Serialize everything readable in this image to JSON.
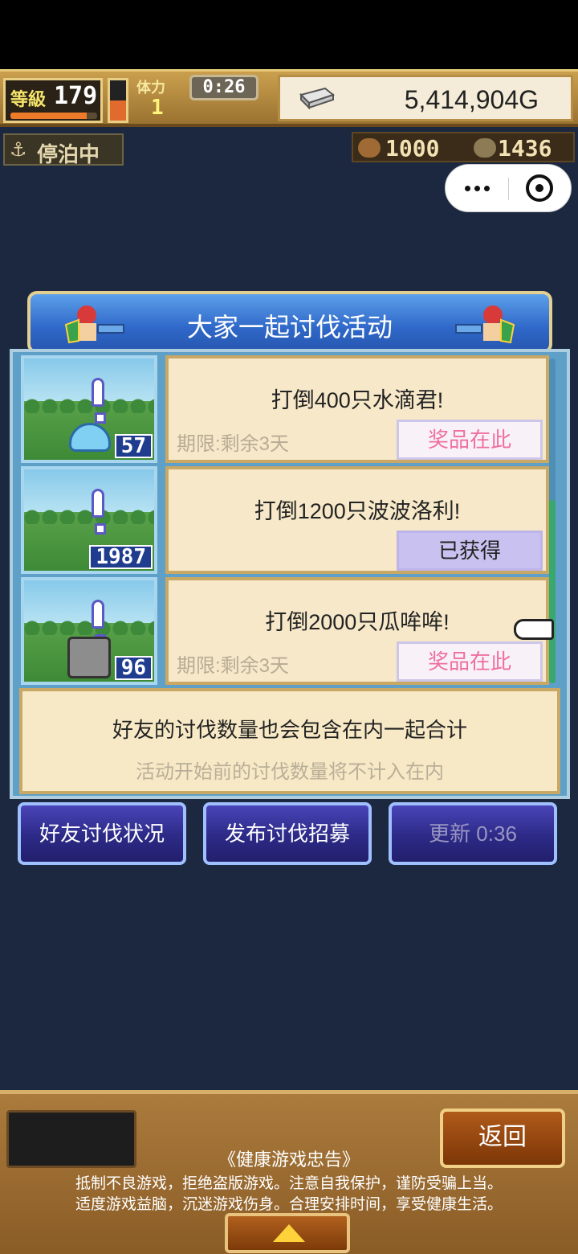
{
  "hud": {
    "level_label": "等級",
    "level_value": "179",
    "exp_progress": 0.88,
    "stamina_progress": 0.5,
    "tier_label": "体力",
    "tier_value": "1",
    "timer": "0:26",
    "gold": "5,414,904G",
    "dock_status": "停泊中",
    "resource_1": "1000",
    "resource_2": "1436"
  },
  "panel": {
    "title": "大家一起讨伐活动",
    "missions": [
      {
        "title": "打倒400只水滴君!",
        "deadline": "期限:剩余3天",
        "button": "奖品在此",
        "count": "57",
        "state": "reward"
      },
      {
        "title": "打倒1200只波波洛利!",
        "deadline": "",
        "button": "已获得",
        "count": "1987",
        "state": "claimed"
      },
      {
        "title": "打倒2000只瓜哞哞!",
        "deadline": "期限:剩余3天",
        "button": "奖品在此",
        "count": "96",
        "state": "reward"
      }
    ],
    "note_main": "好友的讨伐数量也会包含在内一起合计",
    "note_sub": "活动开始前的讨伐数量将不计入在内"
  },
  "actions": {
    "friend_status": "好友讨伐状况",
    "post_recruit": "发布讨伐招募",
    "refresh": "更新 0:36"
  },
  "footer": {
    "back": "返回",
    "health_title": "《健康游戏忠告》",
    "health_line1": "抵制不良游戏，拒绝盗版游戏。注意自我保护，谨防受骗上当。",
    "health_line2": "适度游戏益脑，沉迷游戏伤身。合理安排时间，享受健康生活。"
  },
  "colors": {
    "accent": "#2f68c9",
    "reward_text": "#ef6fa1",
    "claimed_bg": "#c9c2f0"
  }
}
